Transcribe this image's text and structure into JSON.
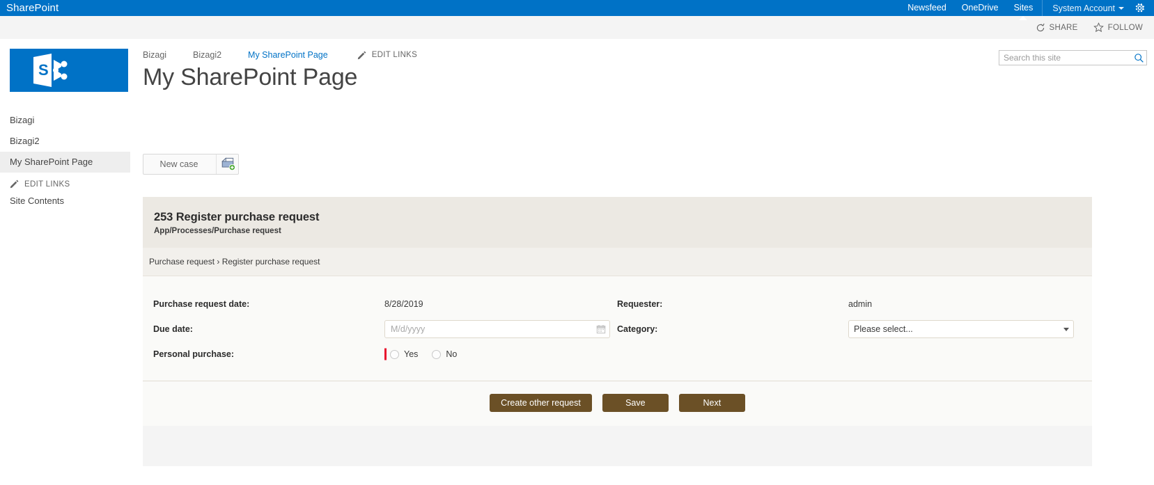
{
  "suitebar": {
    "brand": "SharePoint",
    "links": [
      {
        "label": "Newsfeed",
        "active": false
      },
      {
        "label": "OneDrive",
        "active": false
      },
      {
        "label": "Sites",
        "active": true
      }
    ],
    "user": "System Account",
    "settings_icon": "gear-icon"
  },
  "ribbon": {
    "share": "SHARE",
    "share_icon": "share-icon",
    "follow": "FOLLOW",
    "follow_icon": "star-icon"
  },
  "sidebar": {
    "logo_icon": "sharepoint-logo",
    "items": [
      {
        "label": "Bizagi",
        "selected": false
      },
      {
        "label": "Bizagi2",
        "selected": false
      },
      {
        "label": "My SharePoint Page",
        "selected": true
      }
    ],
    "edit_links": "EDIT LINKS",
    "edit_links_icon": "pencil-icon",
    "site_contents": "Site Contents"
  },
  "topnav": {
    "items": [
      {
        "label": "Bizagi",
        "current": false
      },
      {
        "label": "Bizagi2",
        "current": false
      },
      {
        "label": "My SharePoint Page",
        "current": true
      }
    ],
    "edit_links": "EDIT LINKS",
    "edit_links_icon": "pencil-icon"
  },
  "page_title": "My SharePoint Page",
  "search": {
    "placeholder": "Search this site",
    "value": "",
    "icon": "search-icon"
  },
  "toolbar": {
    "new_case_label": "New case",
    "new_case_icon": "new-document-icon"
  },
  "form": {
    "title": "253 Register purchase request",
    "subtitle": "App/Processes/Purchase request",
    "breadcrumb": "Purchase request › Register purchase request",
    "fields": {
      "purchase_request_date_label": "Purchase request date:",
      "purchase_request_date_value": "8/28/2019",
      "requester_label": "Requester:",
      "requester_value": "admin",
      "due_date_label": "Due date:",
      "due_date_value": "",
      "due_date_placeholder": "M/d/yyyy",
      "due_date_icon": "calendar-icon",
      "category_label": "Category:",
      "category_value": "Please select...",
      "category_caret_icon": "chevron-down-icon",
      "personal_purchase_label": "Personal purchase:",
      "personal_purchase_options": [
        {
          "label": "Yes",
          "checked": false
        },
        {
          "label": "No",
          "checked": false
        }
      ]
    },
    "actions": [
      {
        "label": "Create other request"
      },
      {
        "label": "Save"
      },
      {
        "label": "Next"
      }
    ]
  },
  "colors": {
    "suitebar": "#0072c6",
    "accent_link": "#0072c6",
    "form_header": "#ece9e3",
    "action_button": "#6b5026",
    "required_marker": "#e8112d"
  }
}
